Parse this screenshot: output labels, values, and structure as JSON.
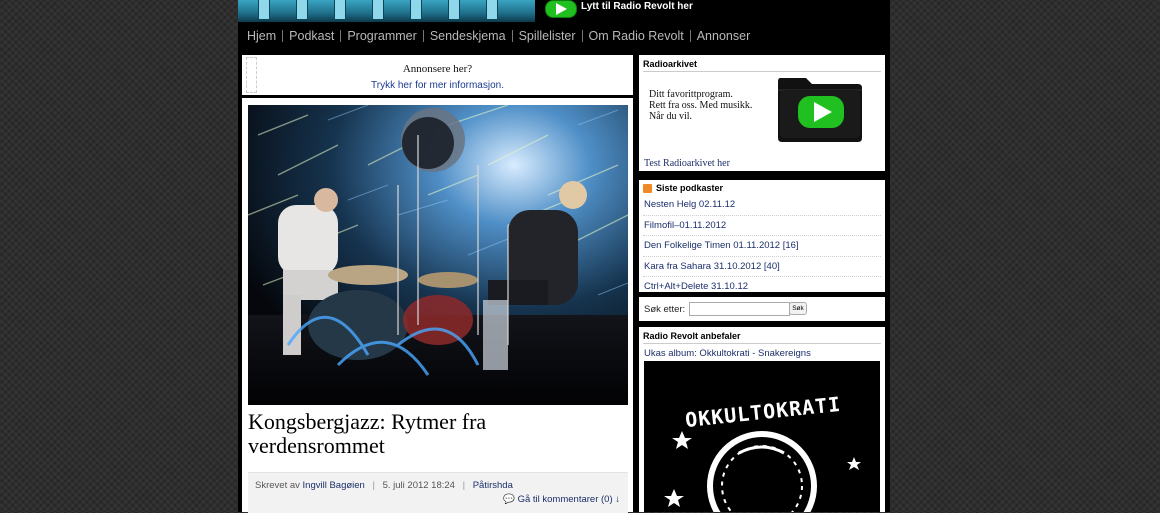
{
  "header": {
    "listen_label": "Lytt til Radio Revolt her"
  },
  "nav": {
    "items": [
      "Hjem",
      "Podkast",
      "Programmer",
      "Sendeskjema",
      "Spillelister",
      "Om Radio Revolt",
      "Annonser"
    ]
  },
  "ad": {
    "title": "Annonsere her?",
    "link": "Trykk her for mer informasjon."
  },
  "post": {
    "title": "Kongsbergjazz: Rytmer fra verdensrommet",
    "meta_prefix": "Skrevet av",
    "author": "Ingvill Bagøien",
    "date": "5. juli 2012 18:24",
    "category": "Påtirshda",
    "comments": "Gå til kommentarer (0) ↓"
  },
  "sidebar": {
    "radioarkivet": {
      "title": "Radioarkivet",
      "lines": [
        "Ditt favorittprogram.",
        "Rett fra oss. Med musikk.",
        "Når du vil."
      ],
      "link": "Test Radioarkivet her"
    },
    "podcasts": {
      "title": "Siste podkaster",
      "items": [
        "Nesten Helg 02.11.12",
        "Filmofil–01.11.2012",
        "Den Folkelige Timen 01.11.2012 [16]",
        "Kara fra Sahara 31.10.2012 [40]",
        "Ctrl+Alt+Delete 31.10.12"
      ]
    },
    "search": {
      "label": "Søk etter:",
      "value": "",
      "button": "Søk"
    },
    "recommends": {
      "title": "Radio Revolt anbefaler",
      "link": "Ukas album: Okkultokrati - Snakereigns",
      "album_text": "OKKULTOKRATI"
    }
  },
  "colors": {
    "play_green": "#20c020",
    "link_blue": "#1b2f6a",
    "rss_orange": "#f08a24"
  }
}
